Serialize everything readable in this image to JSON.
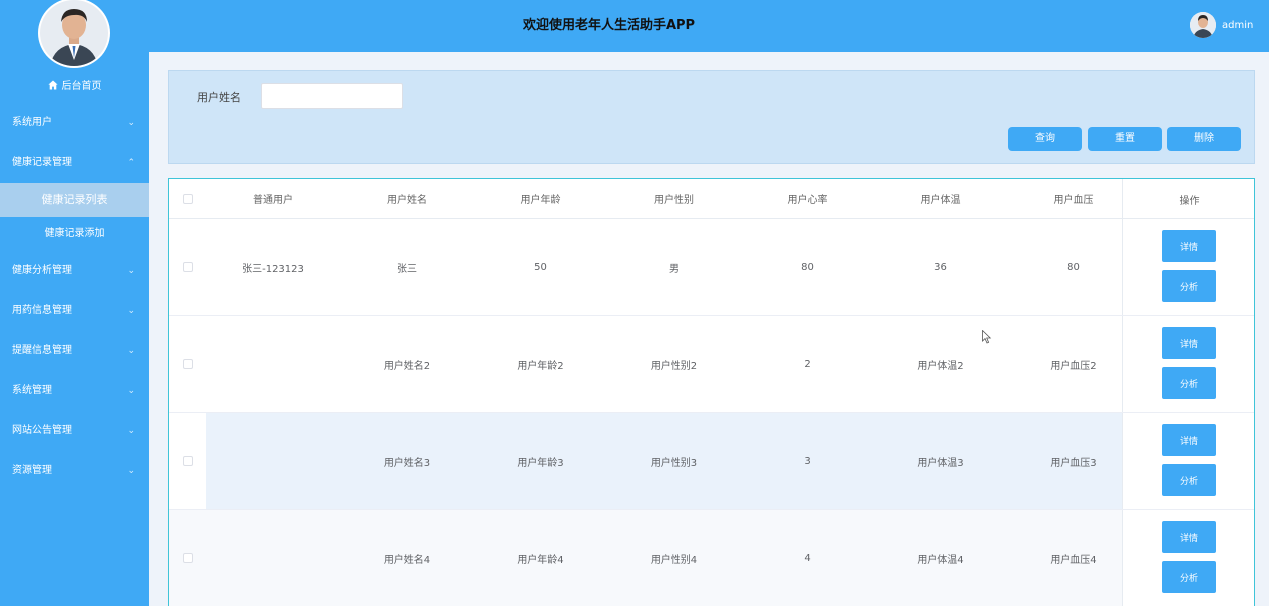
{
  "header": {
    "title": "欢迎使用老年人生活助手APP",
    "user_name": "admin"
  },
  "sidebar": {
    "home_label": "后台首页",
    "menu": [
      {
        "label": "系统用户",
        "chevron": "⌄"
      },
      {
        "label": "健康记录管理",
        "chevron": "⌃"
      }
    ],
    "sub_items": [
      {
        "label": "健康记录列表"
      },
      {
        "label": "健康记录添加"
      }
    ],
    "menu_after": [
      {
        "label": "健康分析管理",
        "chevron": "⌄"
      },
      {
        "label": "用药信息管理",
        "chevron": "⌄"
      },
      {
        "label": "提醒信息管理",
        "chevron": "⌄"
      },
      {
        "label": "系统管理",
        "chevron": "⌄"
      },
      {
        "label": "网站公告管理",
        "chevron": "⌄"
      },
      {
        "label": "资源管理",
        "chevron": "⌄"
      }
    ]
  },
  "search": {
    "label": "用户姓名",
    "value": "",
    "buttons": {
      "query": "查询",
      "reset": "重置",
      "delete": "删除"
    }
  },
  "table": {
    "columns": [
      "普通用户",
      "用户姓名",
      "用户年龄",
      "用户性别",
      "用户心率",
      "用户体温",
      "用户血压",
      "操作"
    ],
    "rows": [
      {
        "user": "张三-123123",
        "name": "张三",
        "age": "50",
        "gender": "男",
        "heart": "80",
        "temp": "36",
        "bp": "80"
      },
      {
        "user": "",
        "name": "用户姓名2",
        "age": "用户年龄2",
        "gender": "用户性别2",
        "heart": "2",
        "temp": "用户体温2",
        "bp": "用户血压2"
      },
      {
        "user": "",
        "name": "用户姓名3",
        "age": "用户年龄3",
        "gender": "用户性别3",
        "heart": "3",
        "temp": "用户体温3",
        "bp": "用户血压3"
      },
      {
        "user": "",
        "name": "用户姓名4",
        "age": "用户年龄4",
        "gender": "用户性别4",
        "heart": "4",
        "temp": "用户体温4",
        "bp": "用户血压4"
      }
    ],
    "actions": {
      "detail": "详情",
      "analyze": "分析"
    }
  },
  "colors": {
    "primary": "#3fa9f5",
    "active_sub": "#a9cfee",
    "panel": "#cfe5f8",
    "table_border": "#3fc4d8"
  }
}
